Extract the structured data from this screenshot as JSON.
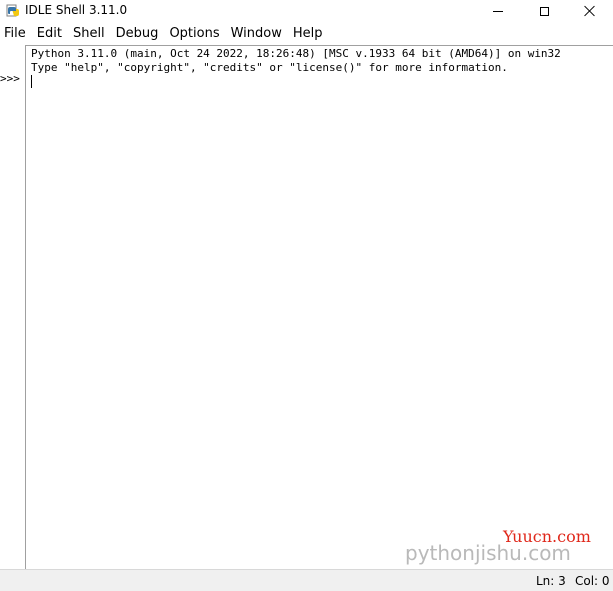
{
  "window": {
    "title": "IDLE Shell 3.11.0",
    "icon": "python-idle-icon"
  },
  "controls": {
    "minimize": "minimize-icon",
    "maximize": "maximize-icon",
    "close": "close-icon"
  },
  "menu": {
    "items": [
      "File",
      "Edit",
      "Shell",
      "Debug",
      "Options",
      "Window",
      "Help"
    ]
  },
  "shell": {
    "prompt": ">>>",
    "lines": [
      "Python 3.11.0 (main, Oct 24 2022, 18:26:48) [MSC v.1933 64 bit (AMD64)] on win32",
      "Type \"help\", \"copyright\", \"credits\" or \"license()\" for more information."
    ]
  },
  "watermark": {
    "site1": "Yuucn.com",
    "site2": "pythonjishu.com"
  },
  "status": {
    "line": "Ln: 3",
    "column": "Col: 0"
  },
  "colors": {
    "watermark_red": "#e0281b",
    "watermark_gray": "#b9b9b9",
    "statusbar_bg": "#f0f0f0"
  }
}
